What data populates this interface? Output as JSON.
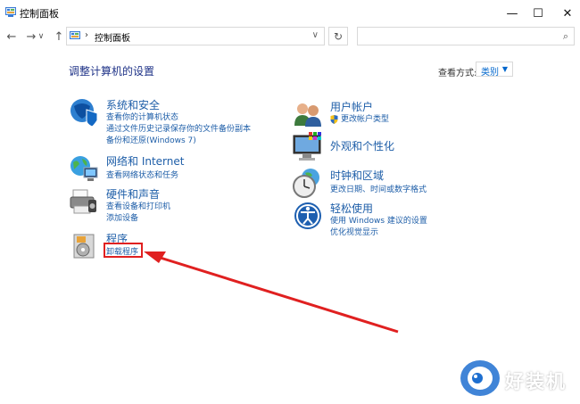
{
  "window": {
    "title": "控制面板",
    "minimize_icon": "—",
    "maximize_icon": "☐",
    "close_icon": "✕"
  },
  "nav": {
    "back": "←",
    "forward": "→",
    "dropdown": "∨",
    "up": "↑"
  },
  "address": {
    "separator": "›",
    "crumb": "控制面板",
    "dropdown": "∨",
    "refresh": "↻"
  },
  "search": {
    "placeholder": "",
    "icon": "⌕"
  },
  "main": {
    "heading": "调整计算机的设置",
    "view_by_label": "查看方式:",
    "view_by_value": "类别",
    "view_by_caret": "▼"
  },
  "categories": {
    "system": {
      "title": "系统和安全",
      "links": [
        "查看你的计算机状态",
        "通过文件历史记录保存你的文件备份副本",
        "备份和还原(Windows 7)"
      ]
    },
    "network": {
      "title": "网络和 Internet",
      "links": [
        "查看网络状态和任务"
      ]
    },
    "hardware": {
      "title": "硬件和声音",
      "links": [
        "查看设备和打印机",
        "添加设备"
      ]
    },
    "programs": {
      "title": "程序",
      "links": [
        "卸载程序"
      ]
    },
    "accounts": {
      "title": "用户帐户",
      "links": [
        "更改帐户类型"
      ]
    },
    "appearance": {
      "title": "外观和个性化",
      "links": []
    },
    "clock": {
      "title": "时钟和区域",
      "links": [
        "更改日期、时间或数字格式"
      ]
    },
    "ease": {
      "title": "轻松使用",
      "links": [
        "使用 Windows 建议的设置",
        "优化视觉显示"
      ]
    }
  },
  "watermark": {
    "text": "好装机"
  },
  "colors": {
    "link": "#1e5ea8",
    "heading": "#1e3287",
    "annotation": "#e02020"
  }
}
